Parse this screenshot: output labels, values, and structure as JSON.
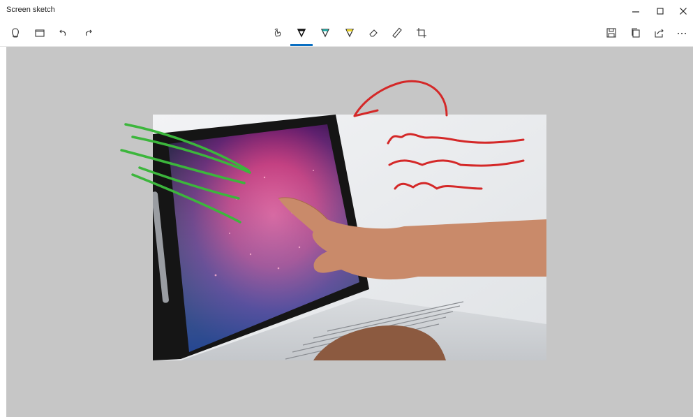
{
  "app": {
    "title": "Screen sketch"
  },
  "window_controls": {
    "minimize_icon": "minimize-icon",
    "maximize_icon": "maximize-icon",
    "close_icon": "close-icon"
  },
  "toolbar": {
    "left": [
      "touch-writing-icon",
      "open-folder-icon",
      "undo-icon",
      "redo-icon"
    ],
    "center": [
      "touch-writing-hand-icon",
      "ballpoint-pen-icon",
      "pencil-icon",
      "highlighter-icon",
      "eraser-icon",
      "ruler-icon",
      "crop-icon"
    ],
    "right": [
      "save-icon",
      "copy-icon",
      "share-icon",
      "more-icon"
    ],
    "active_tool": "ballpoint-pen",
    "active_tab_color": "#0a6fc2"
  },
  "canvas": {
    "background": "#c6c6c6"
  },
  "ink_colors": {
    "green": "#3cb63c",
    "red": "#d42828"
  }
}
